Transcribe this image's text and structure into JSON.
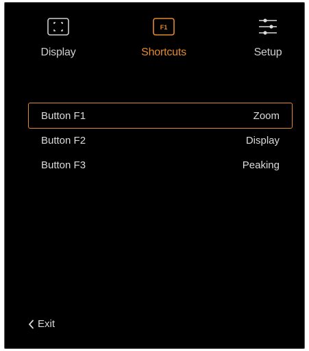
{
  "tabs": {
    "display": {
      "label": "Display",
      "icon": "display-frame-icon"
    },
    "shortcuts": {
      "label": "Shortcuts",
      "icon": "f1-key-icon",
      "icon_text": "F1",
      "active": true
    },
    "setup": {
      "label": "Setup",
      "icon": "sliders-icon"
    }
  },
  "menu": {
    "rows": [
      {
        "label": "Button F1",
        "value": "Zoom",
        "selected": true
      },
      {
        "label": "Button F2",
        "value": "Display",
        "selected": false
      },
      {
        "label": "Button F3",
        "value": "Peaking",
        "selected": false
      }
    ]
  },
  "footer": {
    "exit_label": "Exit",
    "exit_icon": "chevron-left-icon"
  },
  "colors": {
    "background": "#000000",
    "accent": "#e58a2a",
    "text": "#dcdcdc",
    "inactive_label": "#cfcfcf"
  }
}
